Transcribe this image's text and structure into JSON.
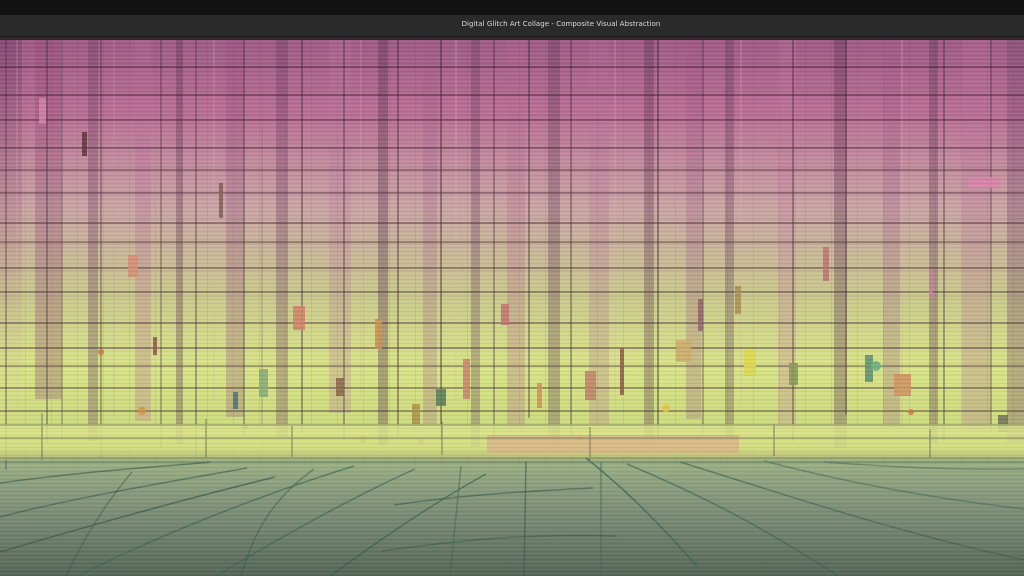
{
  "window": {
    "title": "Digital Glitch Art Collage - Composite Visual Abstraction"
  },
  "artwork": {
    "caption": "",
    "palette": {
      "background": "#18181a",
      "magenta": "#a05d8d",
      "rose": "#c46f9e",
      "violet": "#7f4d78",
      "yellow_green": "#d7e07d",
      "olive_green": "#a6b56b",
      "horizon": "#eaf07f",
      "lower_field": "#7d8b72",
      "road_line": "#2d4e48",
      "shadow": "#3d2b2c"
    }
  }
}
